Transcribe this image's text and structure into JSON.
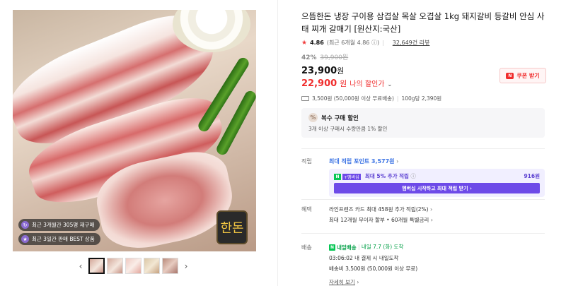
{
  "gallery": {
    "badges": [
      {
        "icon": "repeat-purchase-icon",
        "text": "최근 3개월간 305명 재구매"
      },
      {
        "icon": "best-icon",
        "text": "최근 3일간 판매 BEST 상품"
      }
    ],
    "seal_text": "한돈",
    "thumbnail_count": 5
  },
  "product": {
    "title": "으뜸한돈 냉장 구이용 삼겹살 목살 오겹살 1kg 돼지갈비 등갈비 안심 사태 찌개 갈매기 [원산지:국산]",
    "rating": "4.86",
    "rating_recent": "(최근 6개월 4.86",
    "review_count": "32,649건 리뷰"
  },
  "price": {
    "discount_pct": "42%",
    "original": "39,900원",
    "sale": "23,900",
    "sale_unit": "원",
    "my_price": "22,900",
    "my_price_unit": "원",
    "my_price_label": "나의 할인가",
    "coupon_label": "쿠폰 받기",
    "shipping_line": "3,500원 (50,000원 이상 무료배송)",
    "unit_price": "100g당 2,390원"
  },
  "multi_discount": {
    "title": "복수 구매 할인",
    "desc": "3개 이상 구매시 수량만큼 1% 할인"
  },
  "points": {
    "label": "적립",
    "max_points": "최대 적립 포인트 3,577원",
    "extra_label": "최대 5% 추가 적립",
    "extra_amount": "916원",
    "membership_button": "멤버십 시작하고 최대 적립 받기"
  },
  "benefit": {
    "label": "혜택",
    "line1": "라인프렌즈 카드 최대 458원 추가 적립(2%)",
    "line2": "최대 12개월 무이자 할부 • 60개월 특별금리"
  },
  "delivery": {
    "label": "배송",
    "badge": "내일배송",
    "date": "내일 7.7 (화) 도착",
    "cutoff": "03:06:02  내 결제 시 내일도착",
    "fee": "배송비 3,500원 (50,000원 이상 무료)",
    "more_link": "자세히 보기"
  },
  "colors": {
    "accent_red": "#f02d2d",
    "naver_green": "#07c755",
    "membership_purple": "#6d4ae8",
    "point_blue": "#3b73e4"
  }
}
